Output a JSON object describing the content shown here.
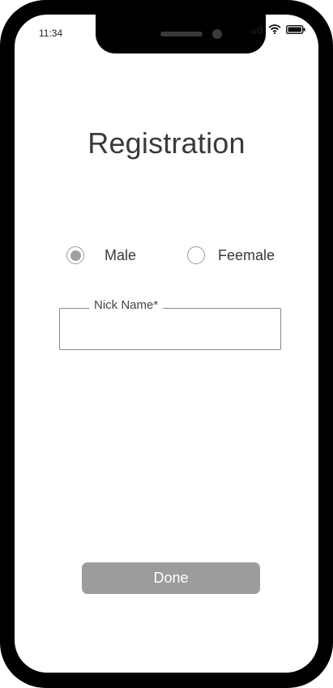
{
  "status_bar": {
    "time": "11:34",
    "icons": [
      "signal-icon",
      "wifi-icon",
      "battery-icon"
    ]
  },
  "page": {
    "title": "Registration"
  },
  "gender": {
    "options": [
      {
        "label": "Male",
        "selected": true
      },
      {
        "label": "Feemale",
        "selected": false
      }
    ]
  },
  "nickname": {
    "label": "Nick Name*",
    "value": ""
  },
  "actions": {
    "done_label": "Done"
  },
  "colors": {
    "frame": "#000000",
    "text": "#3a3a3a",
    "button": "#9c9c9c",
    "radio_selected": "#a0a0a0"
  }
}
